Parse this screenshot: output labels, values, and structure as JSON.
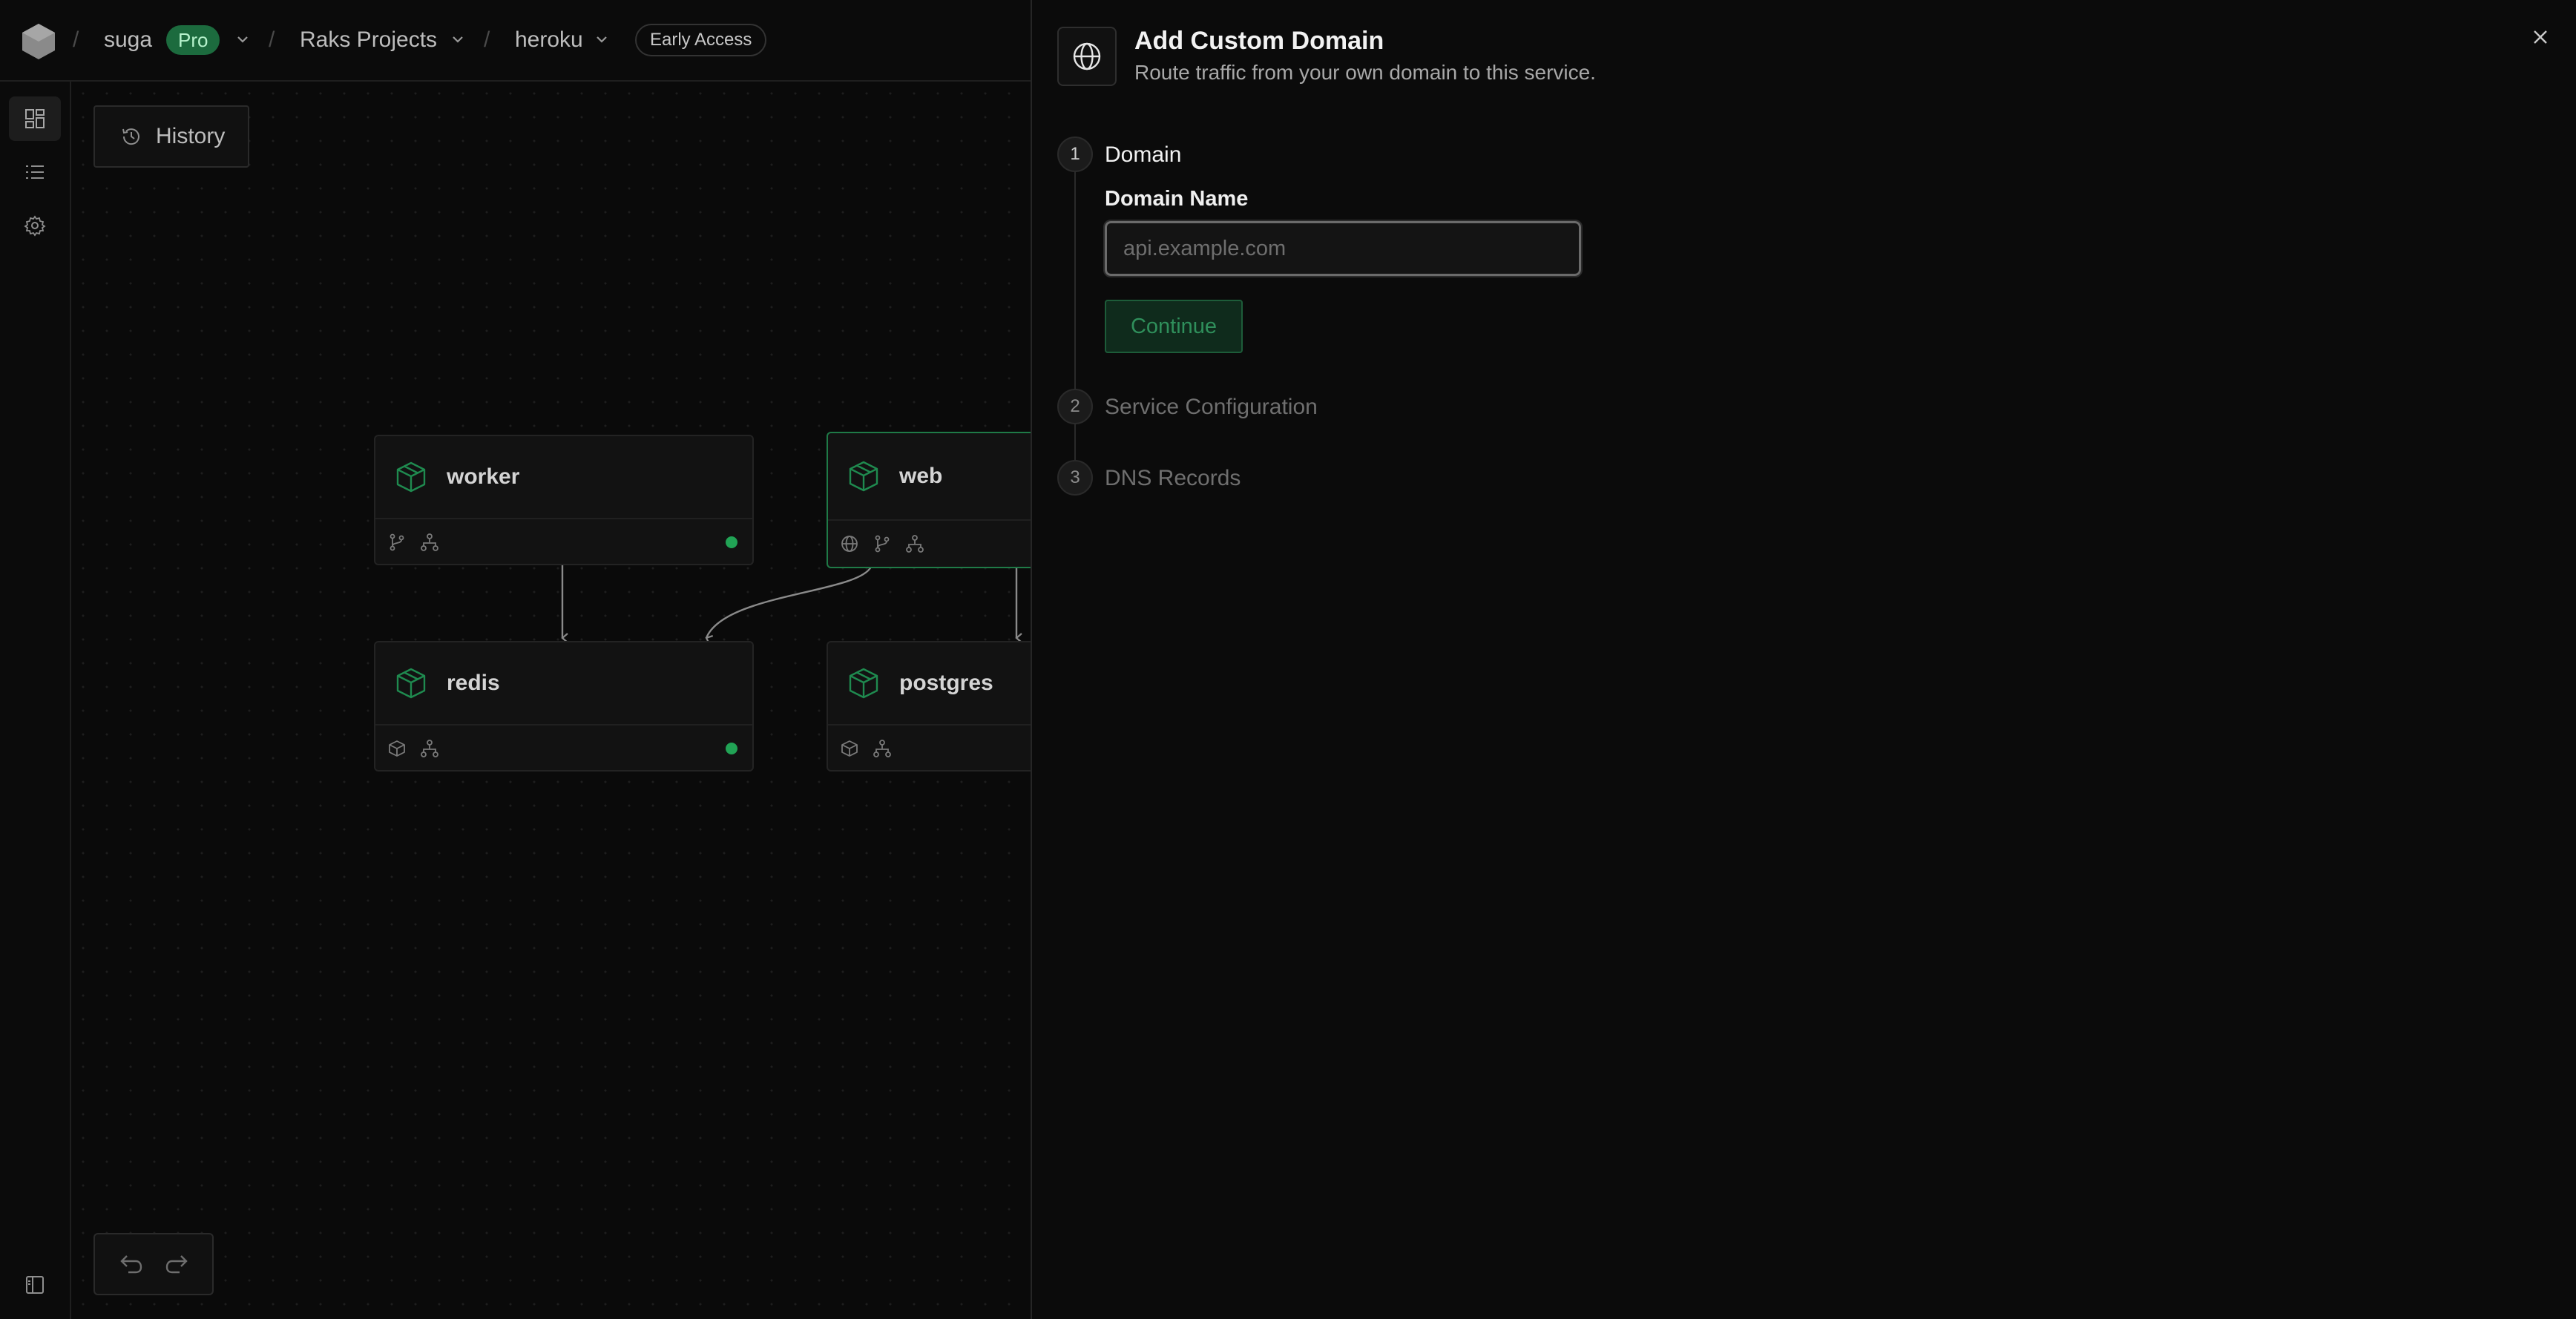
{
  "topbar": {
    "org": "suga",
    "plan_badge": "Pro",
    "project": "Raks Projects",
    "app": "heroku",
    "access_badge": "Early Access",
    "separator": "/"
  },
  "canvas": {
    "history_label": "History",
    "nodes": [
      {
        "name": "worker",
        "status": "online"
      },
      {
        "name": "web",
        "status": "selected"
      },
      {
        "name": "redis",
        "status": "online"
      },
      {
        "name": "postgres",
        "status": "none"
      }
    ]
  },
  "panel": {
    "title": "Add Custom Domain",
    "subtitle": "Route traffic from your own domain to this service.",
    "steps": [
      {
        "number": "1",
        "label": "Domain",
        "state": "active"
      },
      {
        "number": "2",
        "label": "Service Configuration",
        "state": "pending"
      },
      {
        "number": "3",
        "label": "DNS Records",
        "state": "pending"
      }
    ],
    "domain_field": {
      "label": "Domain Name",
      "placeholder": "api.example.com",
      "value": ""
    },
    "continue_label": "Continue"
  },
  "colors": {
    "accent_green": "#21a355",
    "selected_border": "#1f7a47",
    "background": "#0a0a0a"
  }
}
